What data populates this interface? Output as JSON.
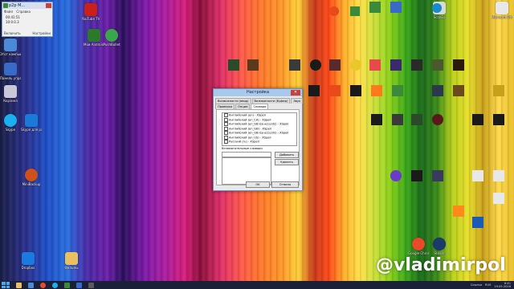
{
  "mini_window": {
    "title": "p2p M...",
    "menu": [
      "Файл",
      "Справка"
    ],
    "values": [
      "00:41:51",
      "10:0.0.3"
    ],
    "bottom_left": "Включить",
    "bottom_right": "Настройки"
  },
  "desktop_icons": [
    {
      "label": "YouTube TV",
      "color": "#c8201a",
      "icon": "tv-icon"
    },
    {
      "label": "Мои Android устройства",
      "color": "#2a7a2a",
      "icon": "android-icon"
    },
    {
      "label": "PushBullet",
      "color": "#3aa84a",
      "icon": "pushbullet-icon"
    },
    {
      "label": "Этот компьютер",
      "color": "#4a8ad8",
      "icon": "computer-icon"
    },
    {
      "label": "Панель управления",
      "color": "#3a6ac8",
      "icon": "control-panel-icon"
    },
    {
      "label": "Корзина",
      "color": "#c8c8d8",
      "icon": "recycle-bin-icon"
    },
    {
      "label": "Skype",
      "color": "#1ab0f0",
      "icon": "skype-icon"
    },
    {
      "label": "Skype для рабочего...",
      "color": "#1a7ad8",
      "icon": "skype-business-icon"
    },
    {
      "label": "MiniBackup",
      "color": "#d0501a",
      "icon": "backup-icon"
    },
    {
      "label": "Dropbox",
      "color": "#1a7ae0",
      "icon": "dropbox-icon"
    },
    {
      "label": "Фильмы",
      "color": "#e8c060",
      "icon": "folder-icon"
    },
    {
      "label": "ScanEx",
      "color": "#d8d8d8",
      "icon": "scan-icon"
    },
    {
      "label": "Microsoft Office Ma...",
      "color": "#e8e8e8",
      "icon": "office-icon"
    },
    {
      "label": "Google Chrome",
      "color": "#e84a2a",
      "icon": "chrome-icon"
    },
    {
      "label": "Steam",
      "color": "#1a3a6a",
      "icon": "steam-icon"
    }
  ],
  "dialog": {
    "title": "Настройка",
    "close": "✕",
    "tabs_row1": [
      "Возможности (ввод)",
      "Возможности (Буфер)",
      "Звук"
    ],
    "tabs_row2": [
      "Проверка",
      "Опции",
      "Словари"
    ],
    "active_tab": "Словари",
    "dictionaries": [
      "Английский (en) - XSpell",
      "Английский (en_CA) - XSpell",
      "Английский (en_GB-ize-accents) - XSpell",
      "Английский (en_GB) - XSpell",
      "Английский (en_GB-ise-accents) - XSpell",
      "Английский (en_US) - XSpell",
      "Русский (ru) - XSpell"
    ],
    "custom_label": "Вспомогательные словари",
    "add_button": "Добавить",
    "delete_button": "Удалить",
    "ok_button": "OK",
    "cancel_button": "Отмена"
  },
  "watermark": "@vladimirpol",
  "taskbar": {
    "tray_label": "Ссылки",
    "language": "RUS",
    "time": "6:41",
    "date": "19.05.2016"
  }
}
